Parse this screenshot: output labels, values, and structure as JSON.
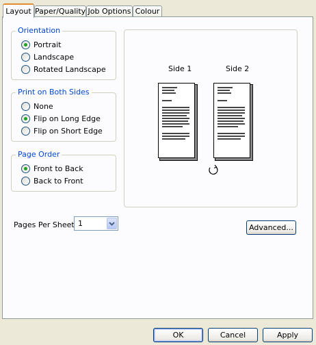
{
  "tabs": [
    "Layout",
    "Paper/Quality",
    "Job Options",
    "Colour"
  ],
  "orientation": {
    "legend": "Orientation",
    "options": [
      "Portrait",
      "Landscape",
      "Rotated Landscape"
    ],
    "selected": "Portrait"
  },
  "duplex": {
    "legend": "Print on Both Sides",
    "options": [
      "None",
      "Flip on Long Edge",
      "Flip on Short Edge"
    ],
    "selected": "Flip on Long Edge"
  },
  "page_order": {
    "legend": "Page Order",
    "options": [
      "Front to Back",
      "Back to Front"
    ],
    "selected": "Front to Back"
  },
  "pages_per_sheet": {
    "label": "Pages Per Sheet:",
    "value": "1"
  },
  "preview": {
    "side1": "Side 1",
    "side2": "Side 2",
    "flip_icon": "flip-arrow-icon"
  },
  "advanced_label": "Advanced...",
  "footer": {
    "ok": "OK",
    "cancel": "Cancel",
    "apply": "Apply"
  },
  "colors": {
    "group_title": "#0046d5",
    "active_tab_accent": "#e68b2c",
    "radio_dot": "#21a121"
  }
}
